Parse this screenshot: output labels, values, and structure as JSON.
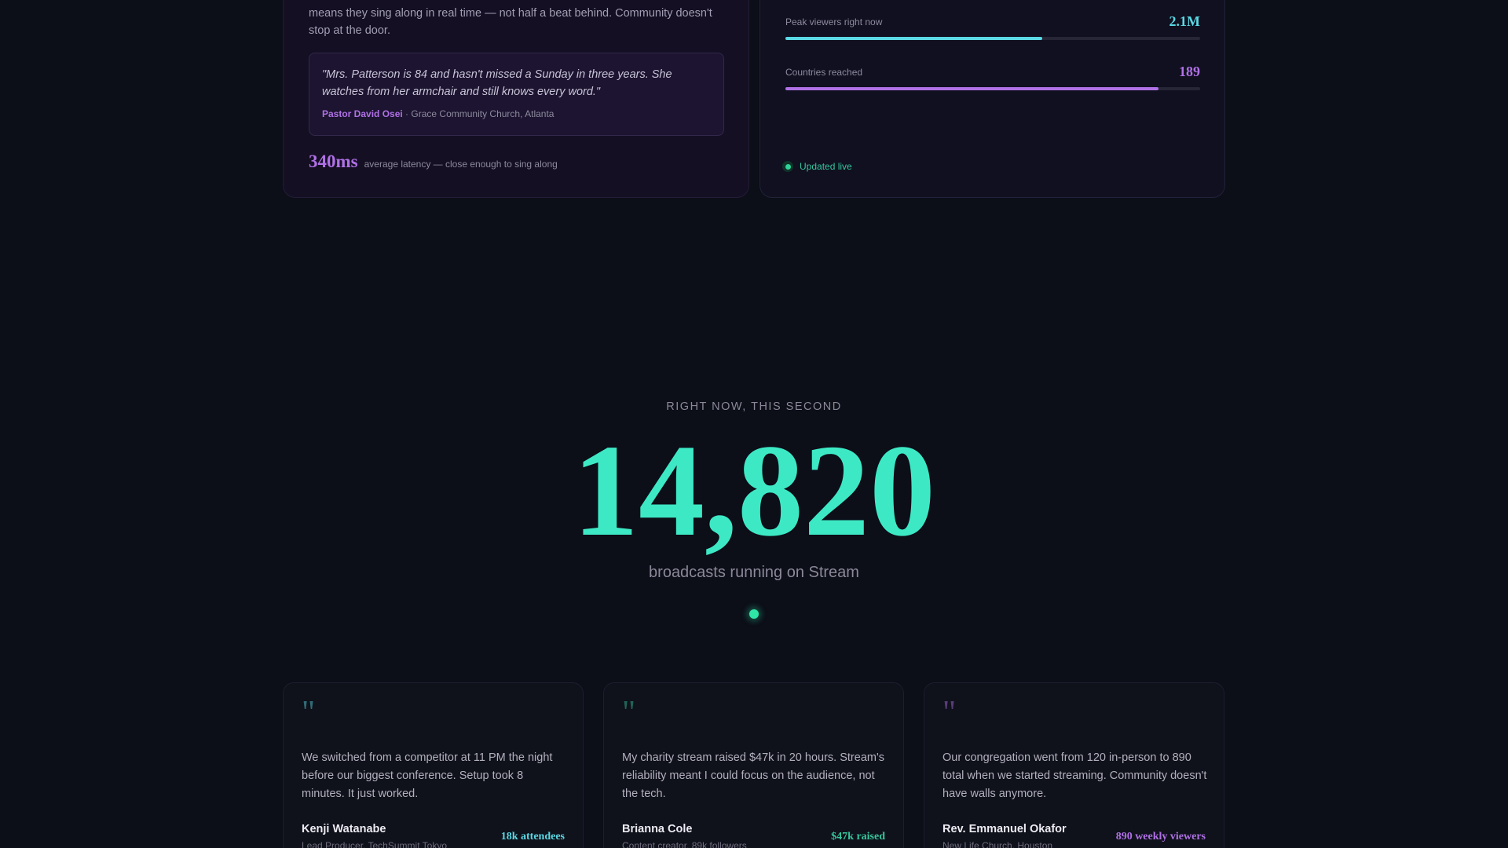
{
  "story": {
    "text": "means they sing along in real time — not half a beat behind. Community doesn't stop at the door.",
    "quote": "\"Mrs. Patterson is 84 and hasn't missed a Sunday in three years. She watches from her armchair and still knows every word.\"",
    "quote_author": "Pastor David Osei",
    "quote_separator": " · ",
    "quote_org": "Grace Community Church, Atlanta",
    "latency_value": "340ms",
    "latency_label": "average latency — close enough to sing along"
  },
  "live_stats": {
    "items": [
      {
        "label": "Peak viewers right now",
        "value": "2.1M",
        "fill": 0.62,
        "color": "#5ad9e4"
      },
      {
        "label": "Countries reached",
        "value": "189",
        "fill": 0.9,
        "color": "#b071e6"
      }
    ],
    "status": "Updated live"
  },
  "hero": {
    "kicker": "RIGHT NOW, THIS SECOND",
    "number": "14,820",
    "subtitle": "broadcasts running on Stream"
  },
  "testimonials": [
    {
      "mark": "\"",
      "text": "We switched from a competitor at 11 PM the night before our biggest conference. Setup took 8 minutes. It just worked.",
      "name": "Kenji Watanabe",
      "role": "Lead Producer, TechSummit Tokyo",
      "metric": "18k attendees",
      "accent": "#5ad9e4"
    },
    {
      "mark": "\"",
      "text": "My charity stream raised $47k in 20 hours. Stream's reliability meant I could focus on the audience, not the tech.",
      "name": "Brianna Cole",
      "role": "Content creator, 89k followers",
      "metric": "$47k raised",
      "accent": "#35c79c"
    },
    {
      "mark": "\"",
      "text": "Our congregation went from 120 in-person to 890 total when we started streaming. Community doesn't have walls anymore.",
      "name": "Rev. Emmanuel Okafor",
      "role": "New Life Church, Houston",
      "metric": "890 weekly viewers",
      "accent": "#b071e6"
    }
  ]
}
